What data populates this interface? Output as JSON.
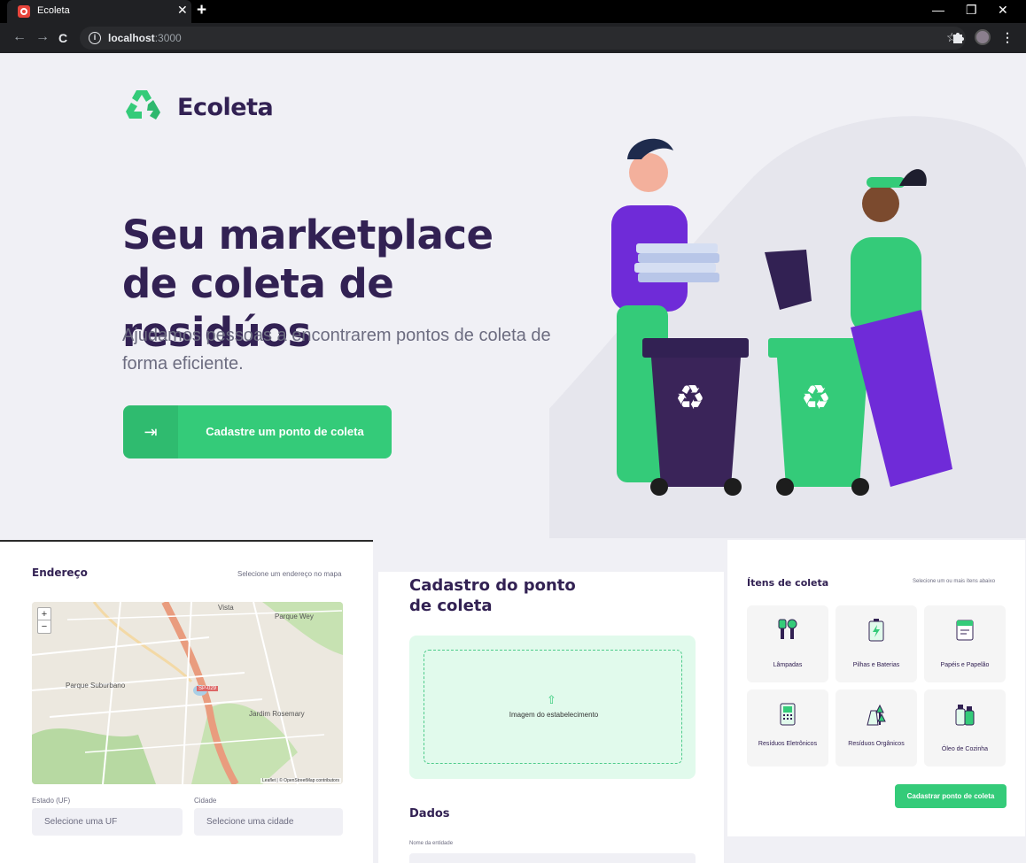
{
  "browser": {
    "tab_title": "Ecoleta",
    "url_host": "localhost",
    "url_port": ":3000"
  },
  "landing": {
    "logo_text": "Ecoleta",
    "title": "Seu marketplace de coleta de residúos",
    "subtitle": "Ajudamos pessoas a encontrarem pontos de coleta de forma eficiente.",
    "cta_label": "Cadastre um ponto de coleta"
  },
  "address": {
    "title": "Endereço",
    "hint": "Selecione um endereço no mapa",
    "map_labels": [
      "Parque Wey",
      "Parque Suburbano",
      "Jardim Rosemary",
      "SP-029",
      "Vista"
    ],
    "attribution": "Leaflet | © OpenStreetMap contributors",
    "uf_label": "Estado (UF)",
    "uf_placeholder": "Selecione uma UF",
    "city_label": "Cidade",
    "city_placeholder": "Selecione uma cidade",
    "zoom_in": "+",
    "zoom_out": "−"
  },
  "form": {
    "title": "Cadastro do ponto de coleta",
    "dropzone_text": "Imagem do estabelecimento",
    "section_title": "Dados",
    "name_label": "Nome da entidade"
  },
  "items": {
    "title": "Ítens de coleta",
    "hint": "Selecione um ou mais ítens abaixo",
    "list": [
      {
        "label": "Lâmpadas",
        "icon": "lamp-icon"
      },
      {
        "label": "Pilhas e Baterias",
        "icon": "battery-icon"
      },
      {
        "label": "Papéis e Papelão",
        "icon": "paper-icon"
      },
      {
        "label": "Resíduos Eletrônicos",
        "icon": "electronics-icon"
      },
      {
        "label": "Resíduos Orgânicos",
        "icon": "organic-icon"
      },
      {
        "label": "Óleo de Cozinha",
        "icon": "oil-icon"
      }
    ],
    "submit_label": "Cadastrar ponto de coleta"
  },
  "colors": {
    "primary": "#34cb79",
    "title": "#322153",
    "text": "#6c6c80",
    "background": "#f0f0f5"
  }
}
